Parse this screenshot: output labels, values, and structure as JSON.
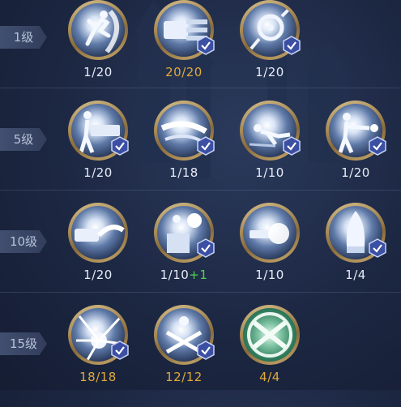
{
  "tiers": [
    {
      "level_label": "1级",
      "skills": [
        {
          "icon": "kick-strike-icon",
          "progress": "1/20",
          "checked": false,
          "gold": false
        },
        {
          "icon": "gatling-barrage-icon",
          "progress": "20/20",
          "checked": true,
          "gold": true
        },
        {
          "icon": "grappling-hook-icon",
          "progress": "1/20",
          "checked": true,
          "gold": false
        }
      ]
    },
    {
      "level_label": "5级",
      "skills": [
        {
          "icon": "heavy-cannon-icon",
          "progress": "1/20",
          "checked": true,
          "gold": false
        },
        {
          "icon": "slash-wave-icon",
          "progress": "1/18",
          "checked": true,
          "gold": false
        },
        {
          "icon": "slide-dash-icon",
          "progress": "1/10",
          "checked": true,
          "gold": false
        },
        {
          "icon": "pistol-fire-icon",
          "progress": "1/20",
          "checked": true,
          "gold": false
        }
      ]
    },
    {
      "level_label": "10级",
      "skills": [
        {
          "icon": "arm-cannon-icon",
          "progress": "1/20",
          "checked": false,
          "gold": false
        },
        {
          "icon": "crate-blast-icon",
          "progress": "1/10",
          "bonus": "+1",
          "checked": true,
          "gold": false
        },
        {
          "icon": "shotgun-blast-icon",
          "progress": "1/10",
          "checked": false,
          "gold": false
        },
        {
          "icon": "missile-warhead-icon",
          "progress": "1/4",
          "checked": true,
          "gold": false
        }
      ]
    },
    {
      "level_label": "15级",
      "skills": [
        {
          "icon": "explosion-burst-icon",
          "progress": "18/18",
          "checked": true,
          "gold": true
        },
        {
          "icon": "dual-blades-icon",
          "progress": "12/12",
          "checked": true,
          "gold": true
        },
        {
          "icon": "crossed-guns-mastery-icon",
          "progress": "4/4",
          "checked": false,
          "gold": true
        }
      ]
    }
  ],
  "colors": {
    "gold_text": "#e0a93a",
    "normal_text": "#e6ebf5",
    "bonus_text": "#4fd64f",
    "check_badge": "#3b4fa3"
  }
}
